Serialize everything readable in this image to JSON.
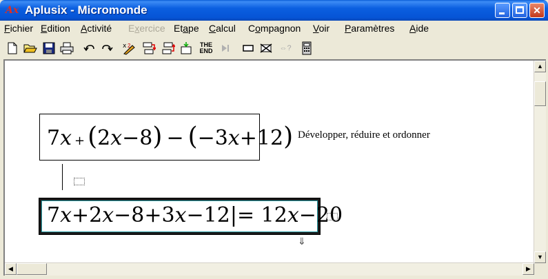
{
  "window": {
    "title": "Aplusix - Micromonde",
    "app_icon_text": "Ax"
  },
  "menu": [
    {
      "label": "Fichier",
      "disabled": false
    },
    {
      "label": "Edition",
      "disabled": false
    },
    {
      "label": "Activité",
      "disabled": false
    },
    {
      "label": "Exercice",
      "disabled": true
    },
    {
      "label": "Etape",
      "disabled": false
    },
    {
      "label": "Calcul",
      "disabled": false
    },
    {
      "label": "Compagnon",
      "disabled": false
    },
    {
      "label": "Voir",
      "disabled": false
    },
    {
      "label": "Paramètres",
      "disabled": false
    },
    {
      "label": "Aide",
      "disabled": false
    }
  ],
  "toolbar": {
    "the_end_label_1": "THE",
    "the_end_label_2": "END",
    "help_label": "⇔?"
  },
  "exercise": {
    "instruction": "Développer, réduire et ordonner"
  },
  "expr1": {
    "t1": "7",
    "t1v": "x",
    "t2": "+",
    "p1o": "(",
    "t3": "2",
    "t3v": "x",
    "t4": "−8",
    "p1c": ")",
    "t5": "−",
    "p2o": "(",
    "t6": "−3",
    "t6v": "x",
    "t7": "+12",
    "p2c": ")"
  },
  "expr2": {
    "a": "7",
    "av": "x",
    "b": "+2",
    "bv": "x",
    "c": "−8+3",
    "cv": "x",
    "d": "−12",
    "cursor": "|",
    "e": "= 12",
    "ev": "x",
    "f": "−20"
  }
}
